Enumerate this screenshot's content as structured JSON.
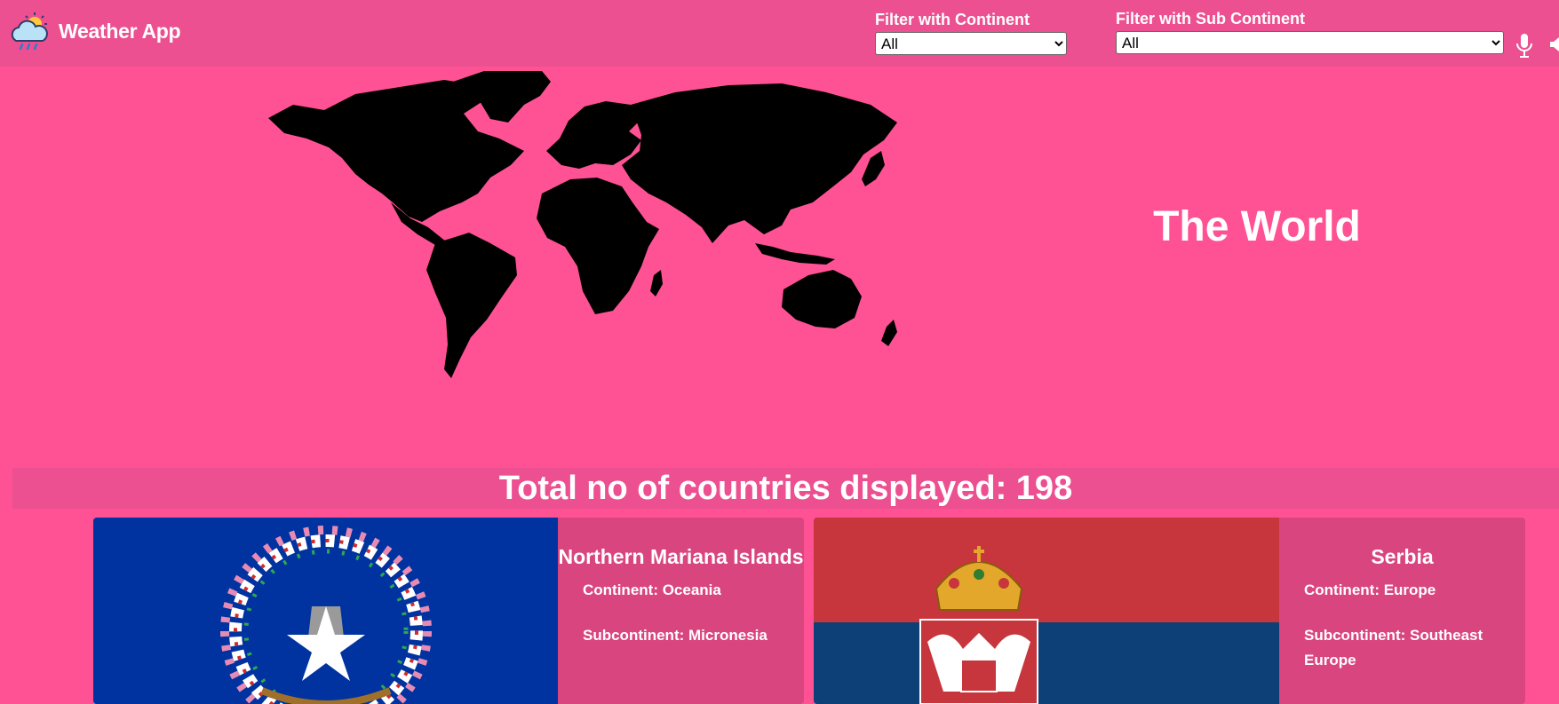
{
  "header": {
    "app_title": "Weather App",
    "continent_filter": {
      "label": "Filter with Continent",
      "selected": "All"
    },
    "subcontinent_filter": {
      "label": "Filter with Sub Continent",
      "selected": "All"
    }
  },
  "hero": {
    "title": "The World"
  },
  "summary": {
    "text": "Total no of countries displayed: 198"
  },
  "countries": [
    {
      "name": "Northern Mariana Islands",
      "continent": "Continent: Oceania",
      "subcontinent": "Subcontinent: Micronesia",
      "flag": "northern-mariana-islands-flag"
    },
    {
      "name": "Serbia",
      "continent": "Continent: Europe",
      "subcontinent": "Subcontinent: Southeast Europe",
      "flag": "serbia-flag"
    }
  ],
  "colors": {
    "background": "#ff5294",
    "navbar": "#ec5090",
    "card_info": "#d9457f"
  }
}
